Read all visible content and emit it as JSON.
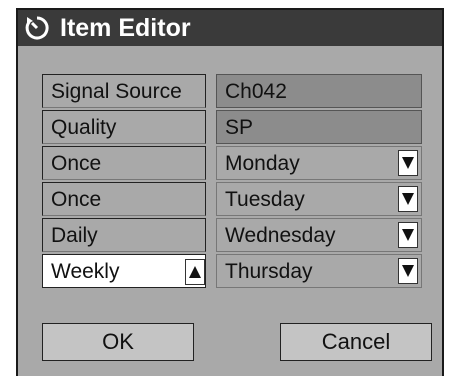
{
  "title": "Item Editor",
  "title_icon": "timer-icon",
  "rows": [
    {
      "label": "Signal Source",
      "value": "Ch042",
      "has_arrow": false
    },
    {
      "label": "Quality",
      "value": "SP",
      "has_arrow": false
    },
    {
      "label": "Once",
      "value": "Monday",
      "has_arrow": true
    },
    {
      "label": "Once",
      "value": "Tuesday",
      "has_arrow": true
    },
    {
      "label": "Daily",
      "value": "Wednesday",
      "has_arrow": true
    },
    {
      "label": "Weekly",
      "value": "Thursday",
      "has_arrow": true
    }
  ],
  "active_row": 5,
  "buttons": {
    "ok": "OK",
    "cancel": "Cancel"
  },
  "colors": {
    "panel": "#a9a9a9",
    "titlebar": "#3a3a3a",
    "fixed_cell": "#8c8c8c",
    "active_cell": "#ffffff"
  }
}
